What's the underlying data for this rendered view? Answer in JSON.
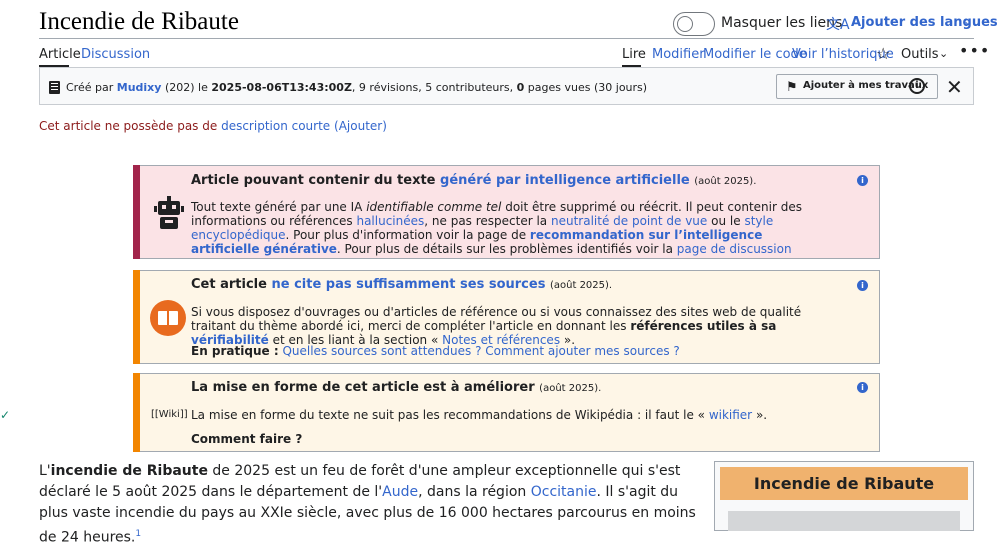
{
  "page": {
    "title": "Incendie de Ribaute"
  },
  "header": {
    "toggle_label": "Masquer les liens",
    "languages_label": "Ajouter des langues"
  },
  "tabs": {
    "left": [
      {
        "label": "Article",
        "active": true
      },
      {
        "label": "Discussion",
        "active": false
      }
    ],
    "right": [
      {
        "label": "Lire",
        "active": true
      },
      {
        "label": "Modifier"
      },
      {
        "label": "Modifier le code"
      },
      {
        "label": "Voir l’historique"
      }
    ],
    "tools_label": "Outils",
    "more_label": "•••"
  },
  "infobar": {
    "created_by": "Créé par",
    "user": "Mudixy",
    "user_edits": "(202)",
    "on": "le",
    "date": "2025-08-06T13:43:00Z",
    "stats_a": ", 9 révisions, 5 contributeurs,",
    "views": "0",
    "stats_b": "pages vues (30 jours)",
    "add_button": "Ajouter à mes travaux"
  },
  "short_description": {
    "prefix": "Cet article ne possède pas de",
    "link": "description courte",
    "add": "(Ajouter)"
  },
  "banners": {
    "ai": {
      "title_prefix": "Article pouvant contenir du texte",
      "title_link": "généré par intelligence artificielle",
      "date": "(août 2025).",
      "body": {
        "t1": "Tout texte généré par une IA",
        "t2": "identifiable comme tel",
        "t3": "doit être supprimé ou réécrit. Il peut contenir des informations ou références",
        "l1": "hallucinées",
        "t4": ", ne pas respecter la",
        "l2": "neutralité de point de vue",
        "t5": "ou le",
        "l3": "style encyclopédique",
        "t6": ". Pour plus d'information voir la page de",
        "l4": "recommandation sur l’intelligence artificielle générative",
        "t7": ". Pour plus de détails sur les problèmes identifiés voir la",
        "l5": "page de discussion"
      }
    },
    "sources": {
      "title_prefix": "Cet article",
      "title_link": "ne cite pas suffisamment ses sources",
      "date": "(août 2025).",
      "body": {
        "t1": "Si vous disposez d'ouvrages ou d'articles de référence ou si vous connaissez des sites web de qualité traitant du thème abordé ici, merci de compléter l'article en donnant les",
        "b1": "références utiles à sa",
        "l1": "vérifiabilité",
        "t2": "et en les liant à la section «",
        "l2": "Notes et références",
        "t3": "»."
      },
      "practice_label": "En pratique :",
      "practice_link1": "Quelles sources sont attendues ?",
      "practice_link2": "Comment ajouter mes sources ?"
    },
    "format": {
      "title": "La mise en forme de cet article est à améliorer",
      "date": "(août 2025).",
      "tag": "[[Wiki]]",
      "body_prefix": "La mise en forme du texte ne suit pas les recommandations de Wikipédia : il faut le «",
      "body_link": "wikifier",
      "body_suffix": "».",
      "howto": "Comment faire ?"
    }
  },
  "article": {
    "p1": "L'",
    "p_bold": "incendie de Ribaute",
    "p2": "de 2025 est un feu de forêt d'une ampleur exceptionnelle qui s'est déclaré le 5 août 2025 dans le département de l'",
    "l_aude": "Aude",
    "p3": ", dans la région",
    "l_occ": "Occitanie",
    "p4": ". Il s'agit du plus vaste incendie du pays au XXIe siècle, avec plus de 16 000 hectares parcourus en moins de 24 heures.",
    "ref": "1"
  },
  "infobox": {
    "title": "Incendie de Ribaute"
  },
  "colors": {
    "link": "#3366cc",
    "ai_stripe": "#a2244b",
    "ai_bg": "#fbe3e6",
    "warn_stripe": "#f28500",
    "warn_bg": "#fef6e7",
    "infobox_header": "#f0b26e"
  }
}
